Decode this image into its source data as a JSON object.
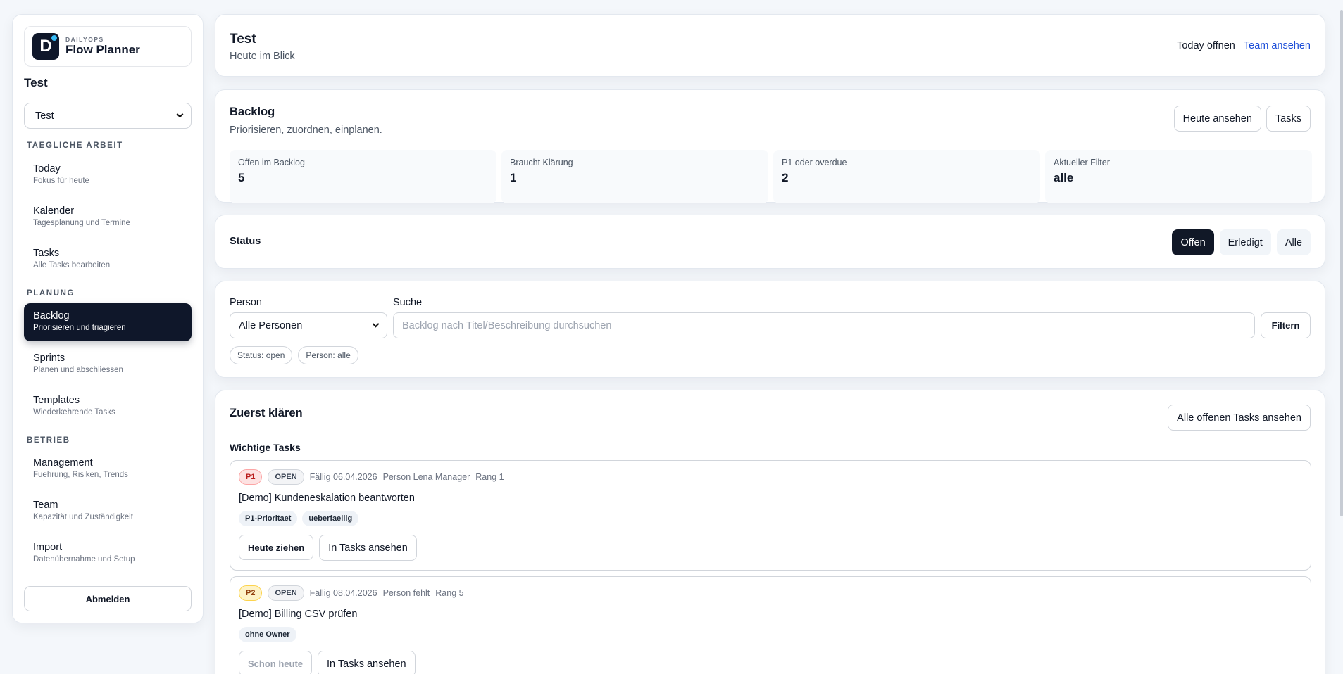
{
  "brand": {
    "kicker": "DAILYOPS",
    "name": "Flow Planner",
    "logo_letter": "D"
  },
  "workspace": {
    "title": "Test",
    "selected": "Test"
  },
  "sidebar": {
    "sections": [
      {
        "label": "TAEGLICHE ARBEIT"
      },
      {
        "label": "PLANUNG"
      },
      {
        "label": "BETRIEB"
      }
    ],
    "items": [
      {
        "title": "Today",
        "subtitle": "Fokus für heute"
      },
      {
        "title": "Kalender",
        "subtitle": "Tagesplanung und Termine"
      },
      {
        "title": "Tasks",
        "subtitle": "Alle Tasks bearbeiten"
      },
      {
        "title": "Backlog",
        "subtitle": "Priorisieren und triagieren",
        "active": true
      },
      {
        "title": "Sprints",
        "subtitle": "Planen und abschliessen"
      },
      {
        "title": "Templates",
        "subtitle": "Wiederkehrende Tasks"
      },
      {
        "title": "Management",
        "subtitle": "Fuehrung, Risiken, Trends"
      },
      {
        "title": "Team",
        "subtitle": "Kapazität und Zuständigkeit"
      },
      {
        "title": "Import",
        "subtitle": "Datenübernahme und Setup"
      }
    ],
    "logout": "Abmelden"
  },
  "header": {
    "title": "Test",
    "subtitle": "Heute im Blick",
    "today_link": "Today öffnen",
    "team_link": "Team ansehen"
  },
  "backlog": {
    "title": "Backlog",
    "subtitle": "Priorisieren, zuordnen, einplanen.",
    "btn_today": "Heute ansehen",
    "btn_tasks": "Tasks",
    "stats": [
      {
        "label": "Offen im Backlog",
        "value": "5"
      },
      {
        "label": "Braucht Klärung",
        "value": "1"
      },
      {
        "label": "P1 oder overdue",
        "value": "2"
      },
      {
        "label": "Aktueller Filter",
        "value": "alle"
      }
    ]
  },
  "status": {
    "label": "Status",
    "options": [
      "Offen",
      "Erledigt",
      "Alle"
    ],
    "selected": "Offen"
  },
  "filters": {
    "person_label": "Person",
    "person_value": "Alle Personen",
    "search_label": "Suche",
    "search_placeholder": "Backlog nach Titel/Beschreibung durchsuchen",
    "filter_button": "Filtern",
    "chips": [
      "Status: open",
      "Person: alle"
    ]
  },
  "clarify": {
    "title": "Zuerst klären",
    "all_button": "Alle offenen Tasks ansehen",
    "subheading": "Wichtige Tasks",
    "tasks": [
      {
        "priority": "P1",
        "state": "OPEN",
        "due": "Fällig 06.04.2026",
        "person": "Person Lena Manager",
        "rank": "Rang 1",
        "title": "[Demo] Kundeneskalation beantworten",
        "tags": [
          "P1-Prioritaet",
          "ueberfaellig"
        ],
        "primary_action": "Heute ziehen",
        "secondary_action": "In Tasks ansehen"
      },
      {
        "priority": "P2",
        "state": "OPEN",
        "due": "Fällig 08.04.2026",
        "person": "Person fehlt",
        "rank": "Rang 5",
        "title": "[Demo] Billing CSV prüfen",
        "tags": [
          "ohne Owner"
        ],
        "primary_action": "Schon heute",
        "secondary_action": "In Tasks ansehen"
      }
    ]
  },
  "colors": {
    "accent": "#0f172a",
    "link": "#1d4ed8",
    "p1_bg": "#fde2e2",
    "p1_fg": "#b91c1c",
    "p2_bg": "#fef3c7",
    "p2_fg": "#92400e"
  }
}
